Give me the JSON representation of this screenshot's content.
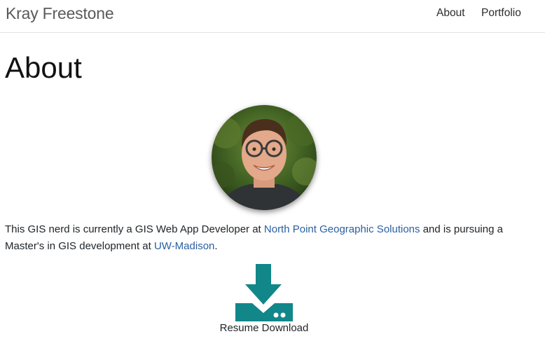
{
  "navbar": {
    "brand": "Kray Freestone",
    "links": [
      {
        "label": "About"
      },
      {
        "label": "Portfolio"
      }
    ]
  },
  "main": {
    "title": "About",
    "bio": {
      "part1": "This GIS nerd is currently a GIS Web App Developer at ",
      "link1": "North Point Geographic Solutions",
      "part2": " and is pursuing a Master's in GIS development at ",
      "link2": "UW-Madison",
      "part3": "."
    },
    "download": {
      "label": "Resume Download",
      "icon": "download-icon"
    }
  },
  "colors": {
    "link": "#2a5fa0",
    "download_icon": "#11878a"
  }
}
